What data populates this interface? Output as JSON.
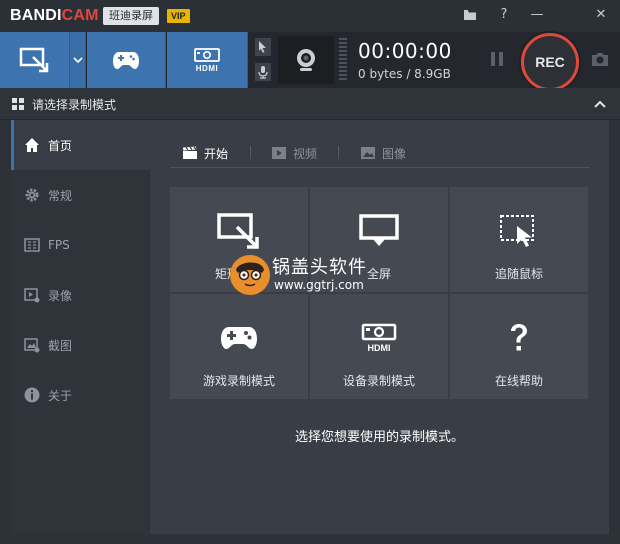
{
  "app": {
    "logo_a": "BANDI",
    "logo_b": "CAM",
    "brand_cn": "班迪录屏",
    "vip_badge": "VIP"
  },
  "titlebar_icons": [
    "folder-icon",
    "help-icon",
    "minimize-icon",
    "close-icon"
  ],
  "titlebar_glyphs": {
    "help": "?",
    "minimize": "—",
    "close": "✕"
  },
  "toolbar": {
    "timer": "00:00:00",
    "size": "0 bytes / 8.9GB",
    "rec_label": "REC",
    "hdmi_label": "HDMI"
  },
  "section": {
    "title": "请选择录制模式"
  },
  "sidebar": {
    "items": [
      {
        "label": "首页",
        "icon": "home-icon"
      },
      {
        "label": "常规",
        "icon": "gear-icon"
      },
      {
        "label": "FPS",
        "icon": "fps-icon"
      },
      {
        "label": "录像",
        "icon": "video-settings-icon"
      },
      {
        "label": "截图",
        "icon": "image-settings-icon"
      },
      {
        "label": "关于",
        "icon": "info-icon"
      }
    ]
  },
  "tabs": [
    {
      "label": "开始",
      "icon": "clapper-icon"
    },
    {
      "label": "视频",
      "icon": "play-icon"
    },
    {
      "label": "图像",
      "icon": "picture-icon"
    }
  ],
  "tiles": [
    {
      "label": "矩形窗口",
      "icon": "rectangle-mode-icon"
    },
    {
      "label": "全屏",
      "icon": "fullscreen-icon"
    },
    {
      "label": "追随鼠标",
      "icon": "follow-mouse-icon"
    },
    {
      "label": "游戏录制模式",
      "icon": "gamepad-icon"
    },
    {
      "label": "设备录制模式",
      "icon": "hdmi-icon"
    },
    {
      "label": "在线帮助",
      "icon": "help-icon"
    }
  ],
  "hint": "选择您想要使用的录制模式。",
  "watermark": {
    "cn": "锅盖头软件",
    "url": "www.ggtrj.com"
  },
  "colors": {
    "accent": "#3d74b0",
    "rec": "#e0483e",
    "vip": "#e8b400"
  }
}
